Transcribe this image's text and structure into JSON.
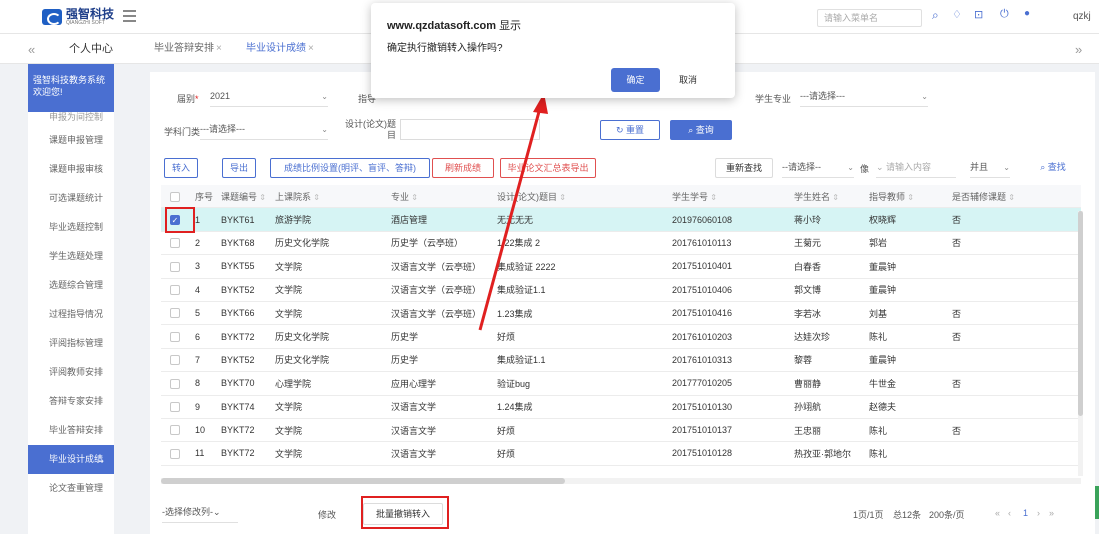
{
  "topbar": {
    "logo_name": "强智科技",
    "logo_sub": "QIANGZHI SOFT",
    "search_placeholder": "请输入菜单名",
    "username": "qzkj",
    "icons": [
      "search-icon",
      "bell-icon",
      "lock-icon",
      "power-icon",
      "user-icon"
    ]
  },
  "tabs": {
    "home": "个人中心",
    "items": [
      {
        "label": "毕业答辩安排",
        "close": "×"
      },
      {
        "label": "毕业设计成绩",
        "close": "×"
      }
    ]
  },
  "sidebar": {
    "welcome": "强智科技教务系统欢迎您!",
    "cut_item": "申报为间控制",
    "items": [
      "课题申报管理",
      "课题申报审核",
      "可选课题统计",
      "毕业选题控制",
      "学生选题处理",
      "选题综合管理",
      "过程指导情况",
      "评阅指标管理",
      "评阅教师安排",
      "答辩专家安排",
      "毕业答辩安排",
      "毕业设计成绩",
      "论文查重管理"
    ],
    "active_index": 11
  },
  "filters": {
    "grade_label": "届别",
    "grade_value": "2021",
    "guide_label": "指导",
    "major_label": "学生专业",
    "major_placeholder": "---请选择---",
    "category_label": "学科门类",
    "category_placeholder": "---请选择---",
    "topic_label_1": "设计(论文)题",
    "topic_label_2": "目",
    "reset": "重置",
    "query": "查询"
  },
  "toolbar": {
    "transfer": "转入",
    "export": "导出",
    "ratio": "成绩比例设置(明评、盲评、答辩)",
    "refresh": "刷新成绩",
    "summary_export": "毕业论文汇总表导出",
    "reset_find": "重新查找",
    "select_placeholder": "--请选择--",
    "like": "像",
    "search_input_placeholder": "请输入内容",
    "and": "并且",
    "find": "查找"
  },
  "table": {
    "headers": [
      "序号",
      "课题编号",
      "上课院系",
      "专业",
      "设计(论文)题目",
      "学生学号",
      "学生姓名",
      "指导教师",
      "是否辅修课题"
    ],
    "rows": [
      [
        "1",
        "BYKT61",
        "旅游学院",
        "酒店管理",
        "无无无无",
        "201976060108",
        "蒋小玲",
        "权晓辉",
        "否",
        true
      ],
      [
        "2",
        "BYKT68",
        "历史文化学院",
        "历史学（云亭班）",
        "1.22集成 2",
        "201761010113",
        "王菊元",
        "郭岩",
        "否",
        false
      ],
      [
        "3",
        "BYKT55",
        "文学院",
        "汉语言文学（云亭班）",
        "集成验证 2222",
        "201751010401",
        "白春香",
        "董晨钟",
        "",
        false
      ],
      [
        "4",
        "BYKT52",
        "文学院",
        "汉语言文学（云亭班）",
        "集成验证1.1",
        "201751010406",
        "郭文博",
        "董晨钟",
        "",
        false
      ],
      [
        "5",
        "BYKT66",
        "文学院",
        "汉语言文学（云亭班）",
        "1.23集成",
        "201751010416",
        "李若冰",
        "刘基",
        "否",
        false
      ],
      [
        "6",
        "BYKT72",
        "历史文化学院",
        "历史学",
        "好烦",
        "201761010203",
        "达娃次珍",
        "陈礼",
        "否",
        false
      ],
      [
        "7",
        "BYKT52",
        "历史文化学院",
        "历史学",
        "集成验证1.1",
        "201761010313",
        "黎蓉",
        "董晨钟",
        "",
        false
      ],
      [
        "8",
        "BYKT70",
        "心理学院",
        "应用心理学",
        "验证bug",
        "201777010205",
        "曹丽静",
        "牛世金",
        "否",
        false
      ],
      [
        "9",
        "BYKT74",
        "文学院",
        "汉语言文学",
        "1.24集成",
        "201751010130",
        "孙翊航",
        "赵德夫",
        "",
        false
      ],
      [
        "10",
        "BYKT72",
        "文学院",
        "汉语言文学",
        "好烦",
        "201751010137",
        "王忠丽",
        "陈礼",
        "否",
        false
      ],
      [
        "11",
        "BYKT72",
        "文学院",
        "汉语言文学",
        "好烦",
        "201751010128",
        "热孜亚·郭地尔",
        "陈礼",
        "",
        false
      ]
    ]
  },
  "footer": {
    "modify_select": "-选择修改列-",
    "modify": "修改",
    "batch_cancel": "批量撤销转入",
    "page_info": "1页/1页",
    "total": "总12条",
    "per_page": "200条/页",
    "page_first": "«",
    "page_prev": "‹",
    "page_num": "1",
    "page_next": "›",
    "page_last": "»"
  },
  "dialog": {
    "site": "www.qzdatasoft.com",
    "title_suffix": "显示",
    "message": "确定执行撤销转入操作吗?",
    "ok": "确定",
    "cancel": "取消"
  },
  "colors": {
    "accent": "#4a6fd1",
    "highlight": "#e02020",
    "selected_row": "#d6f4f4"
  }
}
